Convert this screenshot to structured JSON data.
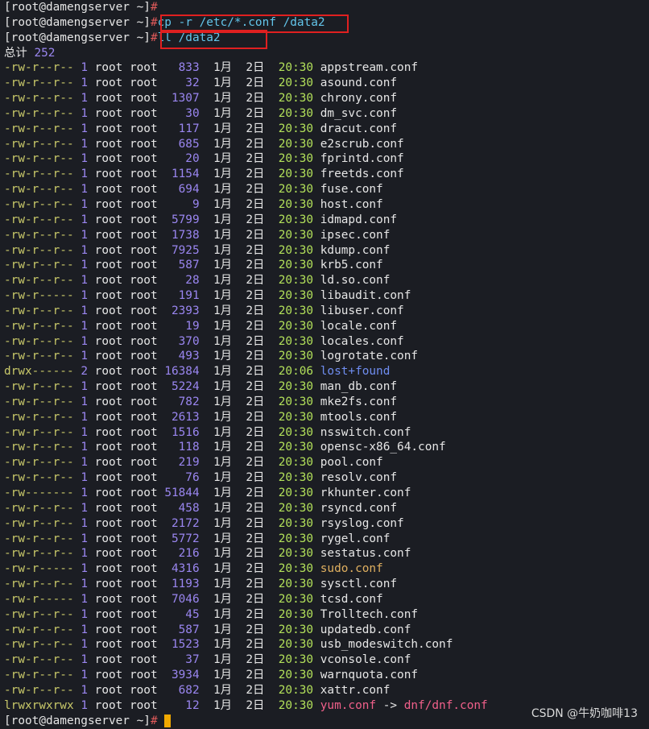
{
  "prompt": "[root@damengserver ~]",
  "prompt_hash": "#",
  "commands": [
    "cp -r /etc/*.conf /data2",
    "ll /data2"
  ],
  "total_label": "总计",
  "total_value": "252",
  "files": [
    {
      "perm": "-rw-r--r--",
      "links": "1",
      "user": "root",
      "group": "root",
      "size": "833",
      "month": "1月",
      "day": "2日",
      "time": "20:30",
      "name": "appstream.conf",
      "type": "file"
    },
    {
      "perm": "-rw-r--r--",
      "links": "1",
      "user": "root",
      "group": "root",
      "size": "32",
      "month": "1月",
      "day": "2日",
      "time": "20:30",
      "name": "asound.conf",
      "type": "file"
    },
    {
      "perm": "-rw-r--r--",
      "links": "1",
      "user": "root",
      "group": "root",
      "size": "1307",
      "month": "1月",
      "day": "2日",
      "time": "20:30",
      "name": "chrony.conf",
      "type": "file"
    },
    {
      "perm": "-rw-r--r--",
      "links": "1",
      "user": "root",
      "group": "root",
      "size": "30",
      "month": "1月",
      "day": "2日",
      "time": "20:30",
      "name": "dm_svc.conf",
      "type": "file"
    },
    {
      "perm": "-rw-r--r--",
      "links": "1",
      "user": "root",
      "group": "root",
      "size": "117",
      "month": "1月",
      "day": "2日",
      "time": "20:30",
      "name": "dracut.conf",
      "type": "file"
    },
    {
      "perm": "-rw-r--r--",
      "links": "1",
      "user": "root",
      "group": "root",
      "size": "685",
      "month": "1月",
      "day": "2日",
      "time": "20:30",
      "name": "e2scrub.conf",
      "type": "file"
    },
    {
      "perm": "-rw-r--r--",
      "links": "1",
      "user": "root",
      "group": "root",
      "size": "20",
      "month": "1月",
      "day": "2日",
      "time": "20:30",
      "name": "fprintd.conf",
      "type": "file"
    },
    {
      "perm": "-rw-r--r--",
      "links": "1",
      "user": "root",
      "group": "root",
      "size": "1154",
      "month": "1月",
      "day": "2日",
      "time": "20:30",
      "name": "freetds.conf",
      "type": "file"
    },
    {
      "perm": "-rw-r--r--",
      "links": "1",
      "user": "root",
      "group": "root",
      "size": "694",
      "month": "1月",
      "day": "2日",
      "time": "20:30",
      "name": "fuse.conf",
      "type": "file"
    },
    {
      "perm": "-rw-r--r--",
      "links": "1",
      "user": "root",
      "group": "root",
      "size": "9",
      "month": "1月",
      "day": "2日",
      "time": "20:30",
      "name": "host.conf",
      "type": "file"
    },
    {
      "perm": "-rw-r--r--",
      "links": "1",
      "user": "root",
      "group": "root",
      "size": "5799",
      "month": "1月",
      "day": "2日",
      "time": "20:30",
      "name": "idmapd.conf",
      "type": "file"
    },
    {
      "perm": "-rw-r--r--",
      "links": "1",
      "user": "root",
      "group": "root",
      "size": "1738",
      "month": "1月",
      "day": "2日",
      "time": "20:30",
      "name": "ipsec.conf",
      "type": "file"
    },
    {
      "perm": "-rw-r--r--",
      "links": "1",
      "user": "root",
      "group": "root",
      "size": "7925",
      "month": "1月",
      "day": "2日",
      "time": "20:30",
      "name": "kdump.conf",
      "type": "file"
    },
    {
      "perm": "-rw-r--r--",
      "links": "1",
      "user": "root",
      "group": "root",
      "size": "587",
      "month": "1月",
      "day": "2日",
      "time": "20:30",
      "name": "krb5.conf",
      "type": "file"
    },
    {
      "perm": "-rw-r--r--",
      "links": "1",
      "user": "root",
      "group": "root",
      "size": "28",
      "month": "1月",
      "day": "2日",
      "time": "20:30",
      "name": "ld.so.conf",
      "type": "file"
    },
    {
      "perm": "-rw-r-----",
      "links": "1",
      "user": "root",
      "group": "root",
      "size": "191",
      "month": "1月",
      "day": "2日",
      "time": "20:30",
      "name": "libaudit.conf",
      "type": "file"
    },
    {
      "perm": "-rw-r--r--",
      "links": "1",
      "user": "root",
      "group": "root",
      "size": "2393",
      "month": "1月",
      "day": "2日",
      "time": "20:30",
      "name": "libuser.conf",
      "type": "file"
    },
    {
      "perm": "-rw-r--r--",
      "links": "1",
      "user": "root",
      "group": "root",
      "size": "19",
      "month": "1月",
      "day": "2日",
      "time": "20:30",
      "name": "locale.conf",
      "type": "file"
    },
    {
      "perm": "-rw-r--r--",
      "links": "1",
      "user": "root",
      "group": "root",
      "size": "370",
      "month": "1月",
      "day": "2日",
      "time": "20:30",
      "name": "locales.conf",
      "type": "file"
    },
    {
      "perm": "-rw-r--r--",
      "links": "1",
      "user": "root",
      "group": "root",
      "size": "493",
      "month": "1月",
      "day": "2日",
      "time": "20:30",
      "name": "logrotate.conf",
      "type": "file"
    },
    {
      "perm": "drwx------",
      "links": "2",
      "user": "root",
      "group": "root",
      "size": "16384",
      "month": "1月",
      "day": "2日",
      "time": "20:06",
      "name": "lost+found",
      "type": "dir"
    },
    {
      "perm": "-rw-r--r--",
      "links": "1",
      "user": "root",
      "group": "root",
      "size": "5224",
      "month": "1月",
      "day": "2日",
      "time": "20:30",
      "name": "man_db.conf",
      "type": "file"
    },
    {
      "perm": "-rw-r--r--",
      "links": "1",
      "user": "root",
      "group": "root",
      "size": "782",
      "month": "1月",
      "day": "2日",
      "time": "20:30",
      "name": "mke2fs.conf",
      "type": "file"
    },
    {
      "perm": "-rw-r--r--",
      "links": "1",
      "user": "root",
      "group": "root",
      "size": "2613",
      "month": "1月",
      "day": "2日",
      "time": "20:30",
      "name": "mtools.conf",
      "type": "file"
    },
    {
      "perm": "-rw-r--r--",
      "links": "1",
      "user": "root",
      "group": "root",
      "size": "1516",
      "month": "1月",
      "day": "2日",
      "time": "20:30",
      "name": "nsswitch.conf",
      "type": "file"
    },
    {
      "perm": "-rw-r--r--",
      "links": "1",
      "user": "root",
      "group": "root",
      "size": "118",
      "month": "1月",
      "day": "2日",
      "time": "20:30",
      "name": "opensc-x86_64.conf",
      "type": "file"
    },
    {
      "perm": "-rw-r--r--",
      "links": "1",
      "user": "root",
      "group": "root",
      "size": "219",
      "month": "1月",
      "day": "2日",
      "time": "20:30",
      "name": "pool.conf",
      "type": "file"
    },
    {
      "perm": "-rw-r--r--",
      "links": "1",
      "user": "root",
      "group": "root",
      "size": "76",
      "month": "1月",
      "day": "2日",
      "time": "20:30",
      "name": "resolv.conf",
      "type": "file"
    },
    {
      "perm": "-rw-------",
      "links": "1",
      "user": "root",
      "group": "root",
      "size": "51844",
      "month": "1月",
      "day": "2日",
      "time": "20:30",
      "name": "rkhunter.conf",
      "type": "file"
    },
    {
      "perm": "-rw-r--r--",
      "links": "1",
      "user": "root",
      "group": "root",
      "size": "458",
      "month": "1月",
      "day": "2日",
      "time": "20:30",
      "name": "rsyncd.conf",
      "type": "file"
    },
    {
      "perm": "-rw-r--r--",
      "links": "1",
      "user": "root",
      "group": "root",
      "size": "2172",
      "month": "1月",
      "day": "2日",
      "time": "20:30",
      "name": "rsyslog.conf",
      "type": "file"
    },
    {
      "perm": "-rw-r--r--",
      "links": "1",
      "user": "root",
      "group": "root",
      "size": "5772",
      "month": "1月",
      "day": "2日",
      "time": "20:30",
      "name": "rygel.conf",
      "type": "file"
    },
    {
      "perm": "-rw-r--r--",
      "links": "1",
      "user": "root",
      "group": "root",
      "size": "216",
      "month": "1月",
      "day": "2日",
      "time": "20:30",
      "name": "sestatus.conf",
      "type": "file"
    },
    {
      "perm": "-rw-r-----",
      "links": "1",
      "user": "root",
      "group": "root",
      "size": "4316",
      "month": "1月",
      "day": "2日",
      "time": "20:30",
      "name": "sudo.conf",
      "type": "exec"
    },
    {
      "perm": "-rw-r--r--",
      "links": "1",
      "user": "root",
      "group": "root",
      "size": "1193",
      "month": "1月",
      "day": "2日",
      "time": "20:30",
      "name": "sysctl.conf",
      "type": "file"
    },
    {
      "perm": "-rw-r-----",
      "links": "1",
      "user": "root",
      "group": "root",
      "size": "7046",
      "month": "1月",
      "day": "2日",
      "time": "20:30",
      "name": "tcsd.conf",
      "type": "file"
    },
    {
      "perm": "-rw-r--r--",
      "links": "1",
      "user": "root",
      "group": "root",
      "size": "45",
      "month": "1月",
      "day": "2日",
      "time": "20:30",
      "name": "Trolltech.conf",
      "type": "file"
    },
    {
      "perm": "-rw-r--r--",
      "links": "1",
      "user": "root",
      "group": "root",
      "size": "587",
      "month": "1月",
      "day": "2日",
      "time": "20:30",
      "name": "updatedb.conf",
      "type": "file"
    },
    {
      "perm": "-rw-r--r--",
      "links": "1",
      "user": "root",
      "group": "root",
      "size": "1523",
      "month": "1月",
      "day": "2日",
      "time": "20:30",
      "name": "usb_modeswitch.conf",
      "type": "file"
    },
    {
      "perm": "-rw-r--r--",
      "links": "1",
      "user": "root",
      "group": "root",
      "size": "37",
      "month": "1月",
      "day": "2日",
      "time": "20:30",
      "name": "vconsole.conf",
      "type": "file"
    },
    {
      "perm": "-rw-r--r--",
      "links": "1",
      "user": "root",
      "group": "root",
      "size": "3934",
      "month": "1月",
      "day": "2日",
      "time": "20:30",
      "name": "warnquota.conf",
      "type": "file"
    },
    {
      "perm": "-rw-r--r--",
      "links": "1",
      "user": "root",
      "group": "root",
      "size": "682",
      "month": "1月",
      "day": "2日",
      "time": "20:30",
      "name": "xattr.conf",
      "type": "file"
    },
    {
      "perm": "lrwxrwxrwx",
      "links": "1",
      "user": "root",
      "group": "root",
      "size": "12",
      "month": "1月",
      "day": "2日",
      "time": "20:30",
      "name": "yum.conf",
      "type": "link",
      "arrow": "->",
      "target": "dnf/dnf.conf"
    }
  ],
  "watermark": "CSDN @牛奶咖啡13",
  "colors": {
    "background": "#1b1d23",
    "highlight_box": "#e02020",
    "cursor": "#f0a800"
  }
}
